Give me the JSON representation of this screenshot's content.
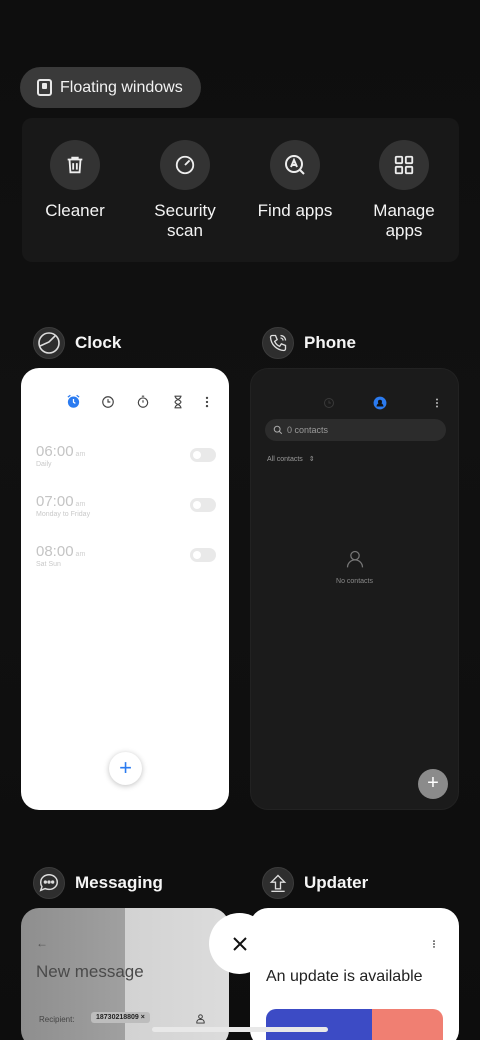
{
  "floating_windows": {
    "label": "Floating windows"
  },
  "tools": [
    {
      "label": "Cleaner",
      "icon": "trash-icon"
    },
    {
      "label": "Security scan",
      "icon": "security-scan-icon"
    },
    {
      "label": "Find apps",
      "icon": "find-apps-icon"
    },
    {
      "label": "Manage apps",
      "icon": "grid-icon"
    }
  ],
  "apps": {
    "clock": {
      "name": "Clock",
      "alarms": [
        {
          "time": "06:00",
          "ampm": "am",
          "sub": "Daily"
        },
        {
          "time": "07:00",
          "ampm": "am",
          "sub": "Monday to Friday"
        },
        {
          "time": "08:00",
          "ampm": "am",
          "sub": "Sat Sun"
        }
      ],
      "add_label": "+"
    },
    "phone": {
      "name": "Phone",
      "search_placeholder": "0 contacts",
      "filter_label": "All contacts",
      "empty_label": "No contacts",
      "add_label": "+"
    },
    "messaging": {
      "name": "Messaging",
      "title": "New message",
      "recipient_label": "Recipient:",
      "recipient_chip": "18730218809 ×"
    },
    "updater": {
      "name": "Updater",
      "title": "An update is available"
    }
  },
  "colors": {
    "accent_blue": "#2b7bf0",
    "background": "#0b0b0b",
    "panel": "#181818"
  }
}
